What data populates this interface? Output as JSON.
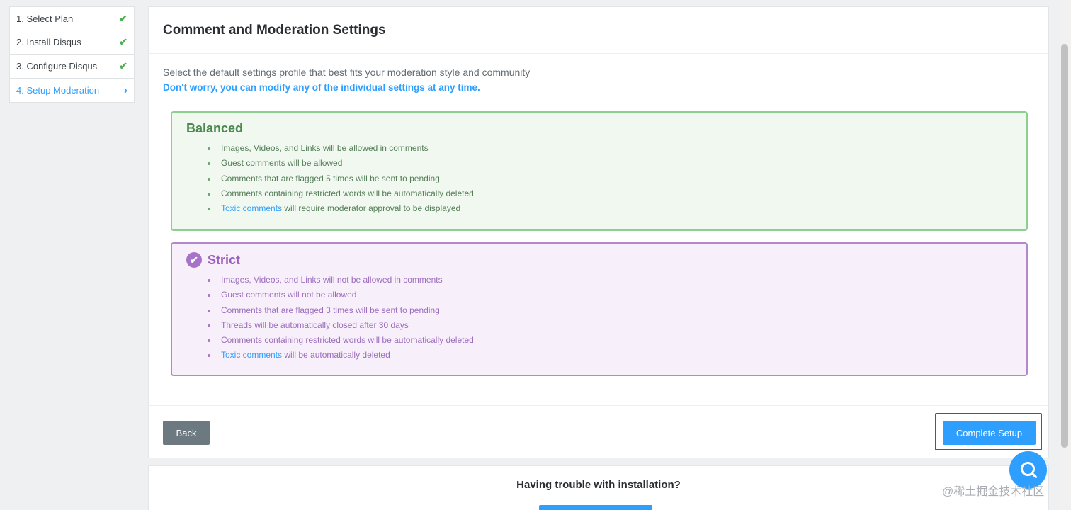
{
  "sidebar": {
    "steps": [
      {
        "label": "1. Select Plan",
        "status": "done"
      },
      {
        "label": "2. Install Disqus",
        "status": "done"
      },
      {
        "label": "3. Configure Disqus",
        "status": "done"
      },
      {
        "label": "4. Setup Moderation",
        "status": "active"
      }
    ],
    "done_icon": "✔",
    "active_icon": "›"
  },
  "main": {
    "title": "Comment and Moderation Settings",
    "description": "Select the default settings profile that best fits your moderation style and community",
    "note": "Don't worry, you can modify any of the individual settings at any time.",
    "profiles": {
      "balanced": {
        "title": "Balanced",
        "items": [
          "Images, Videos, and Links will be allowed in comments",
          "Guest comments will be allowed",
          "Comments that are flagged 5 times will be sent to pending",
          "Comments containing restricted words will be automatically deleted"
        ],
        "toxic_link": "Toxic comments",
        "toxic_rest": " will require moderator approval to be displayed"
      },
      "strict": {
        "title": "Strict",
        "selected": true,
        "items": [
          "Images, Videos, and Links will not be allowed in comments",
          "Guest comments will not be allowed",
          "Comments that are flagged 3 times will be sent to pending",
          "Threads will be automatically closed after 30 days",
          "Comments containing restricted words will be automatically deleted"
        ],
        "toxic_link": "Toxic comments",
        "toxic_rest": " will be automatically deleted"
      }
    },
    "back_label": "Back",
    "complete_label": "Complete Setup"
  },
  "help": {
    "title": "Having trouble with installation?"
  },
  "watermark": "@稀土掘金技术社区",
  "colors": {
    "accent": "#2e9fff",
    "balanced_border": "#8ccf8f",
    "strict_border": "#b486cc",
    "highlight": "#e31b1b"
  }
}
